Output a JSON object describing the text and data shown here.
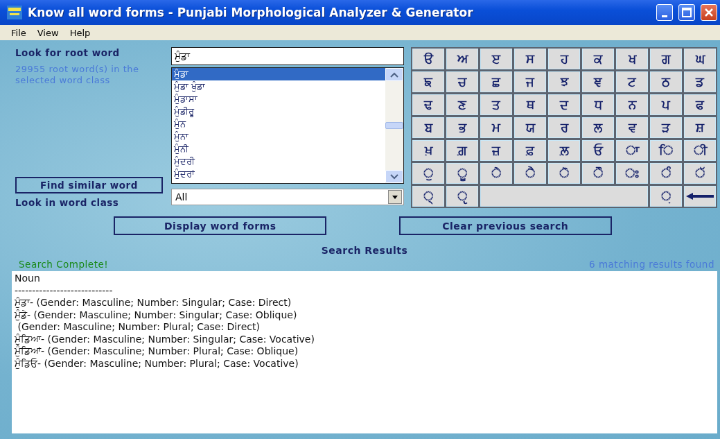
{
  "window": {
    "title": "Know all word forms - Punjabi Morphological Analyzer & Generator"
  },
  "menu": [
    "File",
    "View",
    "Help"
  ],
  "root_search": {
    "label": "Look for root word",
    "value": "ਮੁੰਡਾ",
    "count_note": "29955 root word(s) in the selected word class"
  },
  "word_list": [
    {
      "text": "ਮੁੰਡਾ",
      "selected": true
    },
    {
      "text": "ਮੁੰਡਾ ਖੁੰਡਾ",
      "selected": false
    },
    {
      "text": "ਮੁੰਡਾਸਾ",
      "selected": false
    },
    {
      "text": "ਮੁੰਡੀਰੂ",
      "selected": false
    },
    {
      "text": "ਮੁੰਨ",
      "selected": false
    },
    {
      "text": "ਮੁੰਨਾ",
      "selected": false
    },
    {
      "text": "ਮੁੰਨੀ",
      "selected": false
    },
    {
      "text": "ਮੁੰਦਰੀ",
      "selected": false
    },
    {
      "text": "ਮੁੰਦਰਾਂ",
      "selected": false
    }
  ],
  "find_similar_button": "Find similar word",
  "word_class": {
    "label": "Look in word class",
    "value": "All"
  },
  "keyboard": [
    [
      {
        "kind": "char",
        "label": "ੳ"
      },
      {
        "kind": "char",
        "label": "ਅ"
      },
      {
        "kind": "char",
        "label": "ੲ"
      },
      {
        "kind": "char",
        "label": "ਸ"
      },
      {
        "kind": "char",
        "label": "ਹ"
      },
      {
        "kind": "char",
        "label": "ਕ"
      },
      {
        "kind": "char",
        "label": "ਖ"
      },
      {
        "kind": "char",
        "label": "ਗ"
      },
      {
        "kind": "char",
        "label": "ਘ"
      }
    ],
    [
      {
        "kind": "char",
        "label": "ਙ"
      },
      {
        "kind": "char",
        "label": "ਚ"
      },
      {
        "kind": "char",
        "label": "ਛ"
      },
      {
        "kind": "char",
        "label": "ਜ"
      },
      {
        "kind": "char",
        "label": "ਝ"
      },
      {
        "kind": "char",
        "label": "ਞ"
      },
      {
        "kind": "char",
        "label": "ਟ"
      },
      {
        "kind": "char",
        "label": "ਠ"
      },
      {
        "kind": "char",
        "label": "ਡ"
      }
    ],
    [
      {
        "kind": "char",
        "label": "ਢ"
      },
      {
        "kind": "char",
        "label": "ਣ"
      },
      {
        "kind": "char",
        "label": "ਤ"
      },
      {
        "kind": "char",
        "label": "ਥ"
      },
      {
        "kind": "char",
        "label": "ਦ"
      },
      {
        "kind": "char",
        "label": "ਧ"
      },
      {
        "kind": "char",
        "label": "ਨ"
      },
      {
        "kind": "char",
        "label": "ਪ"
      },
      {
        "kind": "char",
        "label": "ਫ"
      }
    ],
    [
      {
        "kind": "char",
        "label": "ਬ"
      },
      {
        "kind": "char",
        "label": "ਭ"
      },
      {
        "kind": "char",
        "label": "ਮ"
      },
      {
        "kind": "char",
        "label": "ਯ"
      },
      {
        "kind": "char",
        "label": "ਰ"
      },
      {
        "kind": "char",
        "label": "ਲ"
      },
      {
        "kind": "char",
        "label": "ਵ"
      },
      {
        "kind": "char",
        "label": "ੜ"
      },
      {
        "kind": "char",
        "label": "ਸ਼"
      }
    ],
    [
      {
        "kind": "char",
        "label": "ਖ਼"
      },
      {
        "kind": "char",
        "label": "ਗ਼"
      },
      {
        "kind": "char",
        "label": "ਜ਼"
      },
      {
        "kind": "char",
        "label": "ਫ਼"
      },
      {
        "kind": "char",
        "label": "ਲ਼"
      },
      {
        "kind": "char",
        "label": "ਓ"
      },
      {
        "kind": "char",
        "label": "ਾ"
      },
      {
        "kind": "char",
        "label": "ਿ"
      },
      {
        "kind": "char",
        "label": "ੀ"
      }
    ],
    [
      {
        "kind": "char",
        "label": "ੁ"
      },
      {
        "kind": "char",
        "label": "ੂ"
      },
      {
        "kind": "char",
        "label": "ੇ"
      },
      {
        "kind": "char",
        "label": "ੈ"
      },
      {
        "kind": "char",
        "label": "ੋ"
      },
      {
        "kind": "char",
        "label": "ੌ"
      },
      {
        "kind": "char",
        "label": "ਃ"
      },
      {
        "kind": "char",
        "label": "ੰ"
      },
      {
        "kind": "char",
        "label": "ੱ"
      }
    ],
    [
      {
        "kind": "char",
        "label": "੍"
      },
      {
        "kind": "char",
        "label": "ੵ"
      },
      {
        "kind": "space"
      },
      {
        "kind": "char",
        "label": "਼"
      },
      {
        "kind": "backspace"
      }
    ]
  ],
  "actions": [
    "Display word forms",
    "Clear previous search"
  ],
  "results": {
    "title": "Search Results",
    "status": "Search Complete!",
    "count": "6 matching results found",
    "lines": [
      "Noun",
      "----------------------------",
      "ਮੁੰਡਾ- (Gender: Masculine; Number: Singular; Case: Direct)",
      "ਮੁੰਡੇ- (Gender: Masculine; Number: Singular; Case: Oblique)",
      " (Gender: Masculine; Number: Plural; Case: Direct)",
      "ਮੁੰਡਿਆ- (Gender: Masculine; Number: Singular; Case: Vocative)",
      "ਮੁੰਡਿਆਂ- (Gender: Masculine; Number: Plural; Case: Oblique)",
      "ਮੁੰਡਿਓ- (Gender: Masculine; Number: Plural; Case: Vocative)"
    ]
  }
}
